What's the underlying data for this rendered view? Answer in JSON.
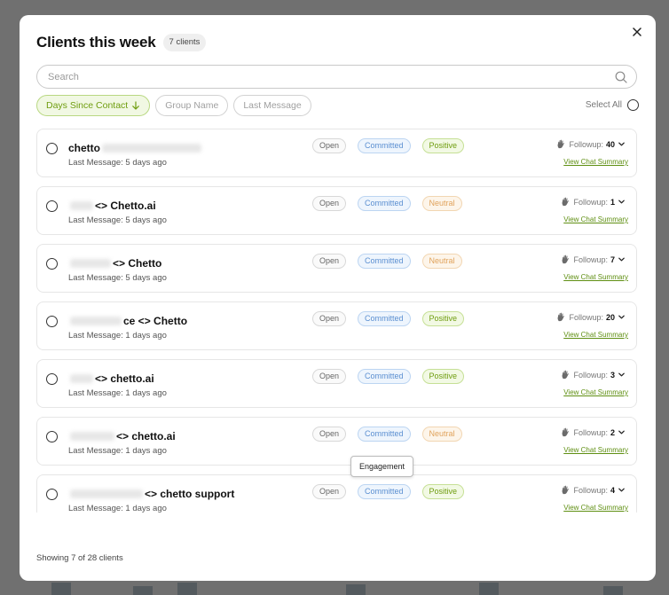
{
  "modal": {
    "title": "Clients this week",
    "count_badge": "7 clients",
    "search_placeholder": "Search",
    "select_all_label": "Select All",
    "footer_text": "Showing 7 of 28 clients",
    "tooltip_text": "Engagement"
  },
  "filters": [
    {
      "label": "Days Since Contact",
      "active": true
    },
    {
      "label": "Group Name",
      "active": false
    },
    {
      "label": "Last Message",
      "active": false
    }
  ],
  "rows": [
    {
      "name_prefix": "chetto",
      "name_suffix": "",
      "last_message": "Last Message: 5 days ago",
      "status": "Open",
      "commitment": "Committed",
      "sentiment": "Positive",
      "sentiment_type": "positive",
      "followup_label": "Followup:",
      "followup_count": "40",
      "summary_link": "View Chat Summary"
    },
    {
      "name_prefix": "",
      "name_suffix": "<> Chetto.ai",
      "last_message": "Last Message: 5 days ago",
      "status": "Open",
      "commitment": "Committed",
      "sentiment": "Neutral",
      "sentiment_type": "neutral",
      "followup_label": "Followup:",
      "followup_count": "1",
      "summary_link": "View Chat Summary"
    },
    {
      "name_prefix": "",
      "name_suffix": "<> Chetto",
      "last_message": "Last Message: 5 days ago",
      "status": "Open",
      "commitment": "Committed",
      "sentiment": "Neutral",
      "sentiment_type": "neutral",
      "followup_label": "Followup:",
      "followup_count": "7",
      "summary_link": "View Chat Summary"
    },
    {
      "name_prefix": "",
      "name_suffix": "ce <> Chetto",
      "last_message": "Last Message: 1 days ago",
      "status": "Open",
      "commitment": "Committed",
      "sentiment": "Positive",
      "sentiment_type": "positive",
      "followup_label": "Followup:",
      "followup_count": "20",
      "summary_link": "View Chat Summary"
    },
    {
      "name_prefix": "",
      "name_suffix": "<> chetto.ai",
      "last_message": "Last Message: 1 days ago",
      "status": "Open",
      "commitment": "Committed",
      "sentiment": "Positive",
      "sentiment_type": "positive",
      "followup_label": "Followup:",
      "followup_count": "3",
      "summary_link": "View Chat Summary"
    },
    {
      "name_prefix": "",
      "name_suffix": "<> chetto.ai",
      "last_message": "Last Message: 1 days ago",
      "status": "Open",
      "commitment": "Committed",
      "sentiment": "Neutral",
      "sentiment_type": "neutral",
      "followup_label": "Followup:",
      "followup_count": "2",
      "summary_link": "View Chat Summary"
    },
    {
      "name_prefix": "",
      "name_suffix": "<> chetto support",
      "last_message": "Last Message: 1 days ago",
      "status": "Open",
      "commitment": "Committed",
      "sentiment": "Positive",
      "sentiment_type": "positive",
      "followup_label": "Followup:",
      "followup_count": "4",
      "summary_link": "View Chat Summary"
    }
  ],
  "icons": {
    "close": "close-icon",
    "search": "search-icon",
    "sort": "arrow-down-icon",
    "followup": "hand-wave-icon",
    "expand": "chevron-down-icon"
  },
  "colors": {
    "accent_green": "#6f9d0f",
    "committed_blue": "#5b8fd1",
    "neutral_orange": "#e0a35c"
  }
}
